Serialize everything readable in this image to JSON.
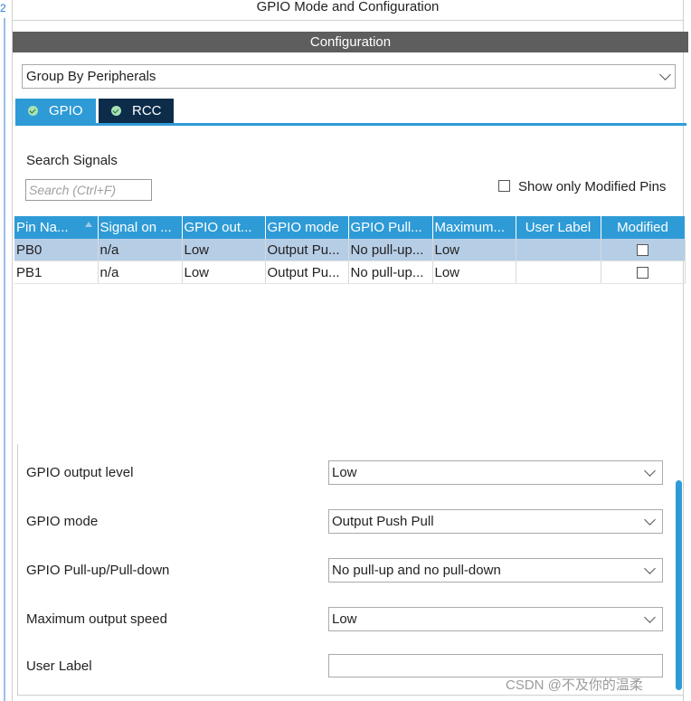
{
  "window": {
    "title": "GPIO Mode and Configuration"
  },
  "left_edge_mark": "2",
  "config": {
    "title": "Configuration"
  },
  "group_by": {
    "value": "Group By Peripherals"
  },
  "tabs": [
    {
      "label": "GPIO",
      "icon": "check-circle-icon",
      "active": true
    },
    {
      "label": "RCC",
      "icon": "check-circle-icon",
      "active": false
    }
  ],
  "search": {
    "title": "Search Signals",
    "placeholder": "Search (Ctrl+F)",
    "show_modified_label": "Show only Modified Pins"
  },
  "table": {
    "headers": [
      "Pin Na...",
      "Signal on ...",
      "GPIO out...",
      "GPIO mode",
      "GPIO Pull...",
      "Maximum...",
      "User Label",
      "Modified"
    ],
    "rows": [
      {
        "pin": "PB0",
        "signal": "n/a",
        "output": "Low",
        "mode": "Output Pu...",
        "pull": "No pull-up...",
        "speed": "Low",
        "user_label": "",
        "modified": false,
        "selected": true
      },
      {
        "pin": "PB1",
        "signal": "n/a",
        "output": "Low",
        "mode": "Output Pu...",
        "pull": "No pull-up...",
        "speed": "Low",
        "user_label": "",
        "modified": false,
        "selected": false
      }
    ]
  },
  "properties": {
    "output_level": {
      "label": "GPIO output level",
      "value": "Low"
    },
    "mode": {
      "label": "GPIO mode",
      "value": "Output Push Pull"
    },
    "pull": {
      "label": "GPIO Pull-up/Pull-down",
      "value": "No pull-up and no pull-down"
    },
    "speed": {
      "label": "Maximum output speed",
      "value": "Low"
    },
    "user_label": {
      "label": "User Label",
      "value": ""
    }
  },
  "watermark": "CSDN @不及你的温柔",
  "colors": {
    "accent": "#2e9bd6",
    "header_bar": "#5e5e5e",
    "tab_dark": "#0c2c4a",
    "selected_row": "#b6cde6"
  }
}
